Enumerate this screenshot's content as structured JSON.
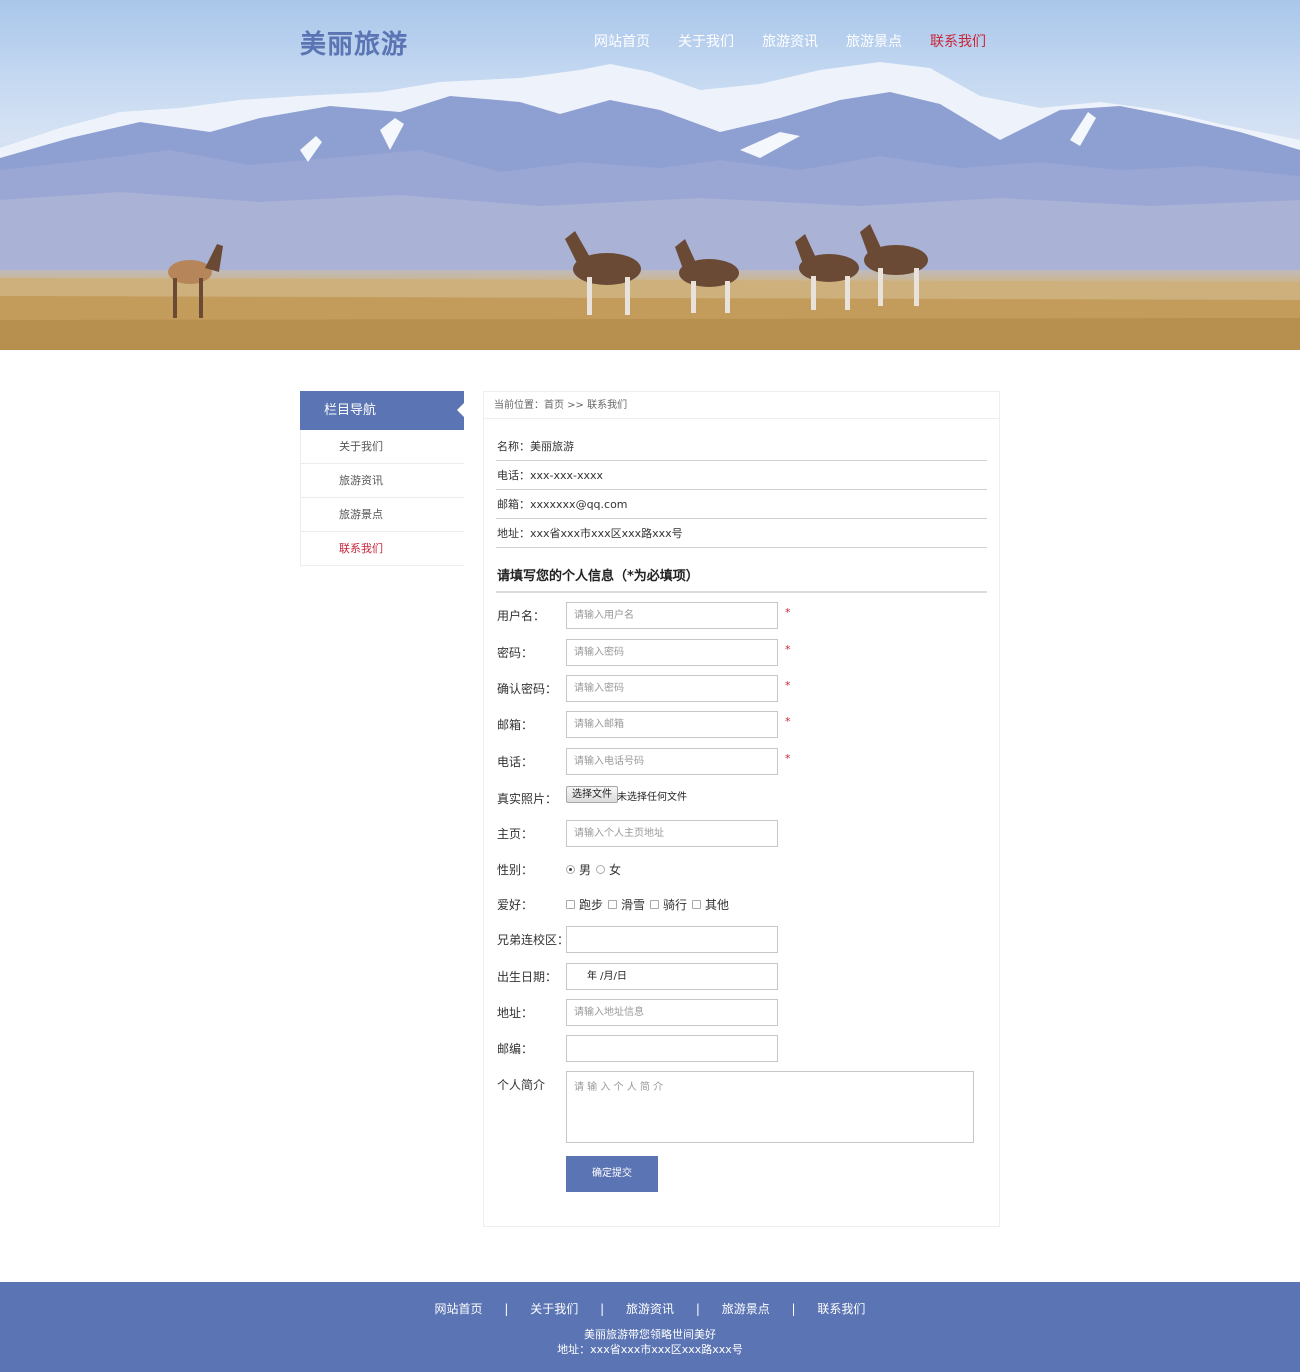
{
  "header": {
    "logo": "美丽旅游",
    "nav": [
      {
        "label": "网站首页"
      },
      {
        "label": "关于我们"
      },
      {
        "label": "旅游资讯"
      },
      {
        "label": "旅游景点"
      },
      {
        "label": "联系我们",
        "active": true
      }
    ]
  },
  "sidebar": {
    "title": "栏目导航",
    "items": [
      {
        "label": "关于我们"
      },
      {
        "label": "旅游资讯"
      },
      {
        "label": "旅游景点"
      },
      {
        "label": "联系我们",
        "active": true
      }
    ]
  },
  "breadcrumb": "当前位置：首页 >> 联系我们",
  "contact": {
    "name": "名称：美丽旅游",
    "phone": "电话：xxx-xxx-xxxx",
    "email": "邮箱：xxxxxxx@qq.com",
    "address": "地址：xxx省xxx市xxx区xxx路xxx号"
  },
  "form": {
    "title": "请填写您的个人信息（*为必填项）",
    "required_mark": "*",
    "username": {
      "label": "用户名：",
      "placeholder": "请输入用户名"
    },
    "password": {
      "label": "密码：",
      "placeholder": "请输入密码"
    },
    "confirm": {
      "label": "确认密码：",
      "placeholder": "请输入密码"
    },
    "email": {
      "label": "邮箱：",
      "placeholder": "请输入邮箱"
    },
    "phone": {
      "label": "电话：",
      "placeholder": "请输入电话号码"
    },
    "photo": {
      "label": "真实照片：",
      "button": "选择文件",
      "status": "未选择任何文件"
    },
    "homepage": {
      "label": "主页：",
      "placeholder": "请输入个人主页地址"
    },
    "gender": {
      "label": "性别：",
      "options": [
        "男",
        "女"
      ],
      "selected": "男"
    },
    "hobby": {
      "label": "爱好：",
      "options": [
        "跑步",
        "滑雪",
        "骑行",
        "其他"
      ]
    },
    "campus": {
      "label": "兄弟连校区：",
      "value": ""
    },
    "birthday": {
      "label": "出生日期：",
      "value": "年 /月/日"
    },
    "address": {
      "label": "地址：",
      "placeholder": "请输入地址信息"
    },
    "zipcode": {
      "label": "邮编：",
      "value": ""
    },
    "bio": {
      "label": "个人简介",
      "placeholder": "请 输 入 个 人 简 介"
    },
    "submit": "确定提交"
  },
  "footer": {
    "nav": [
      "网站首页",
      "关于我们",
      "旅游资讯",
      "旅游景点",
      "联系我们"
    ],
    "separator": "|",
    "slogan": "美丽旅游带您领略世间美好",
    "address": "地址：xxx省xxx市xxx区xxx路xxx号"
  },
  "colors": {
    "brand": "#5b74b3",
    "accent": "#c8263a"
  }
}
